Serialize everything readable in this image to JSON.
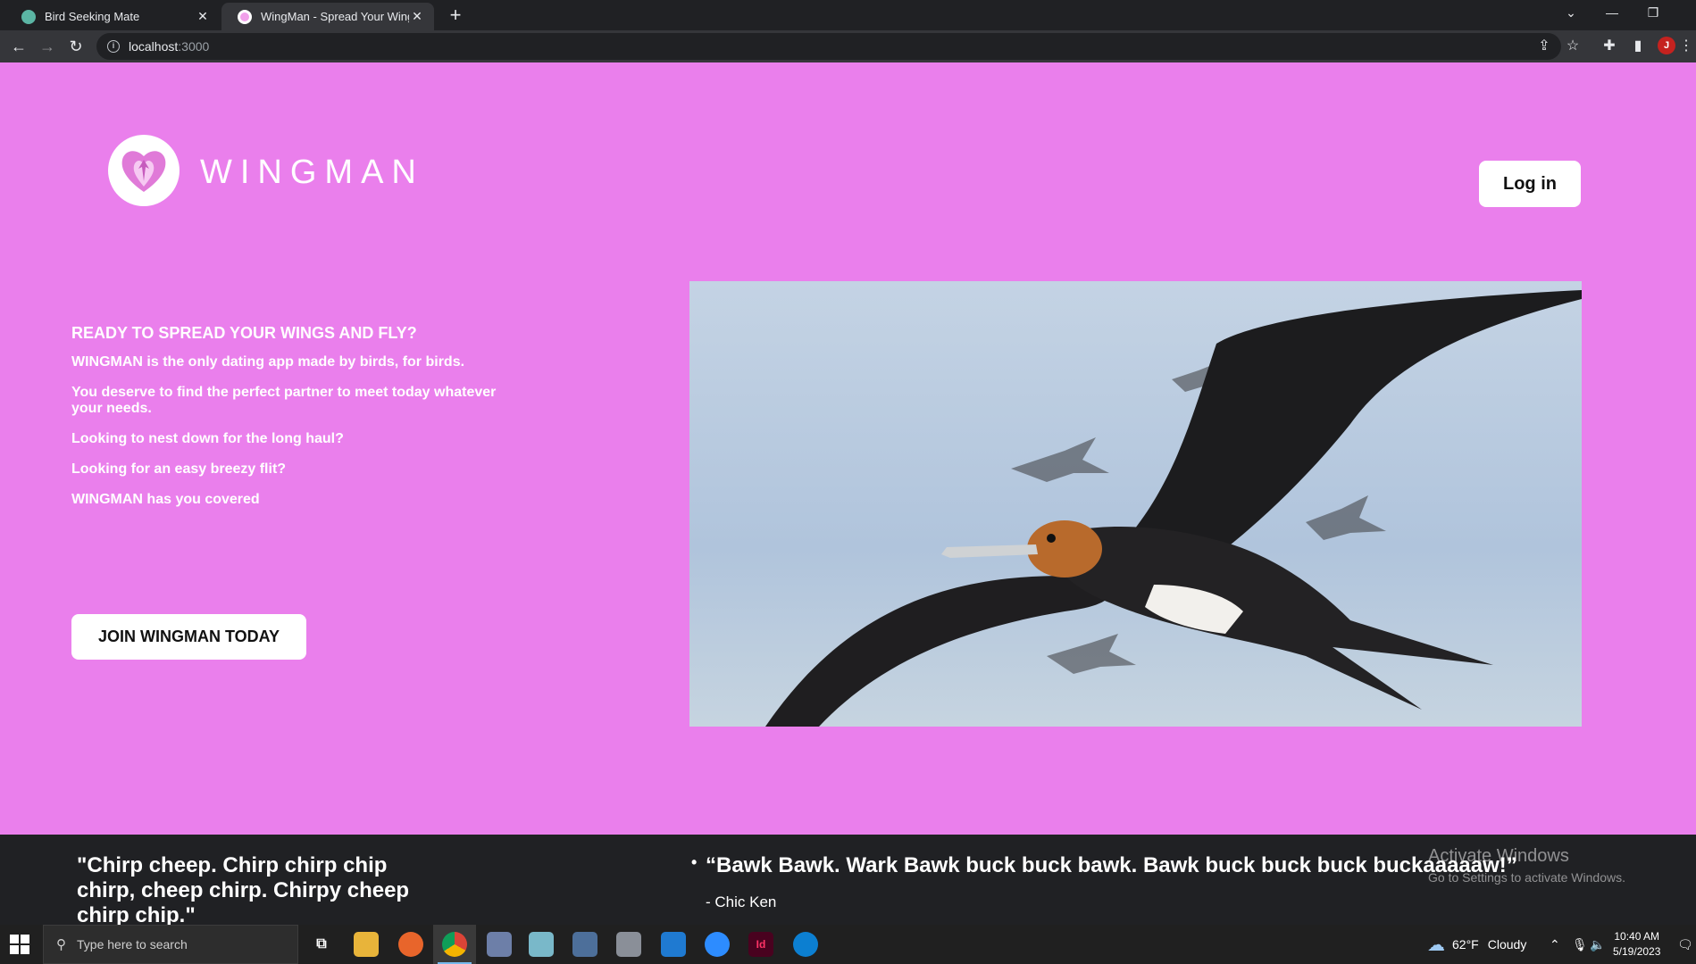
{
  "browser": {
    "tabs": [
      {
        "label": "Bird Seeking Mate",
        "active": false
      },
      {
        "label": "WingMan - Spread Your Wings",
        "active": true
      }
    ],
    "url_host": "localhost",
    "url_port": ":3000",
    "profile_initial": "J"
  },
  "header": {
    "brand": "WINGMAN",
    "login_label": "Log in"
  },
  "hero": {
    "heading": "READY TO SPREAD YOUR WINGS AND FLY?",
    "paragraphs": [
      "WINGMAN is the only dating app made by birds, for birds.",
      "You deserve to find the perfect partner to meet today whatever your needs.",
      "Looking to nest down for the long haul?",
      "Looking for an easy breezy flit?",
      "WINGMAN has you covered"
    ],
    "cta_label": "JOIN WINGMAN TODAY"
  },
  "testimonials": {
    "quote1": "\"Chirp cheep. Chirp chirp chip chirp, cheep chirp. Chirpy cheep chirp chip.\"",
    "quote2": "“Bawk Bawk. Wark Bawk buck buck bawk. Bawk buck buck buck buckaaaaaw!”",
    "author2": "- Chic Ken"
  },
  "watermark": {
    "line1": "Activate Windows",
    "line2": "Go to Settings to activate Windows."
  },
  "taskbar": {
    "search_placeholder": "Type here to search",
    "weather_temp": "62°F",
    "weather_desc": "Cloudy",
    "time": "10:40 AM",
    "date": "5/19/2023"
  },
  "colors": {
    "page_bg": "#ea7fec",
    "footer_bg": "#202124",
    "button_bg": "#ffffff"
  }
}
